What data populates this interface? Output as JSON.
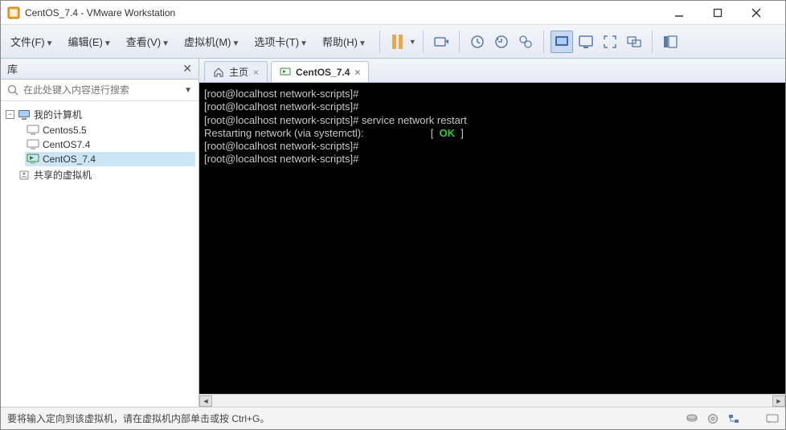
{
  "window": {
    "title": "CentOS_7.4 - VMware Workstation"
  },
  "menu": {
    "file": "文件(F)",
    "edit": "编辑(E)",
    "view": "查看(V)",
    "vm": "虚拟机(M)",
    "tabs": "选项卡(T)",
    "help": "帮助(H)"
  },
  "sidebar": {
    "title": "库",
    "search_placeholder": "在此处键入内容进行搜索",
    "root": "我的计算机",
    "items": [
      "Centos5.5",
      "CentOS7.4",
      "CentOS_7.4"
    ],
    "shared": "共享的虚拟机"
  },
  "tabs": {
    "home": "主页",
    "vm": "CentOS_7.4"
  },
  "terminal": {
    "lines": [
      {
        "text": "[root@localhost network-scripts]# "
      },
      {
        "text": "[root@localhost network-scripts]# "
      },
      {
        "text": "[root@localhost network-scripts]# service network restart"
      },
      {
        "text": "Restarting network (via systemctl):                       [  ",
        "ok": "OK",
        "tail": "  ]"
      },
      {
        "text": "[root@localhost network-scripts]# "
      },
      {
        "text": "[root@localhost network-scripts]# "
      }
    ]
  },
  "status": {
    "text": "要将输入定向到该虚拟机，请在虚拟机内部单击或按 Ctrl+G。"
  }
}
